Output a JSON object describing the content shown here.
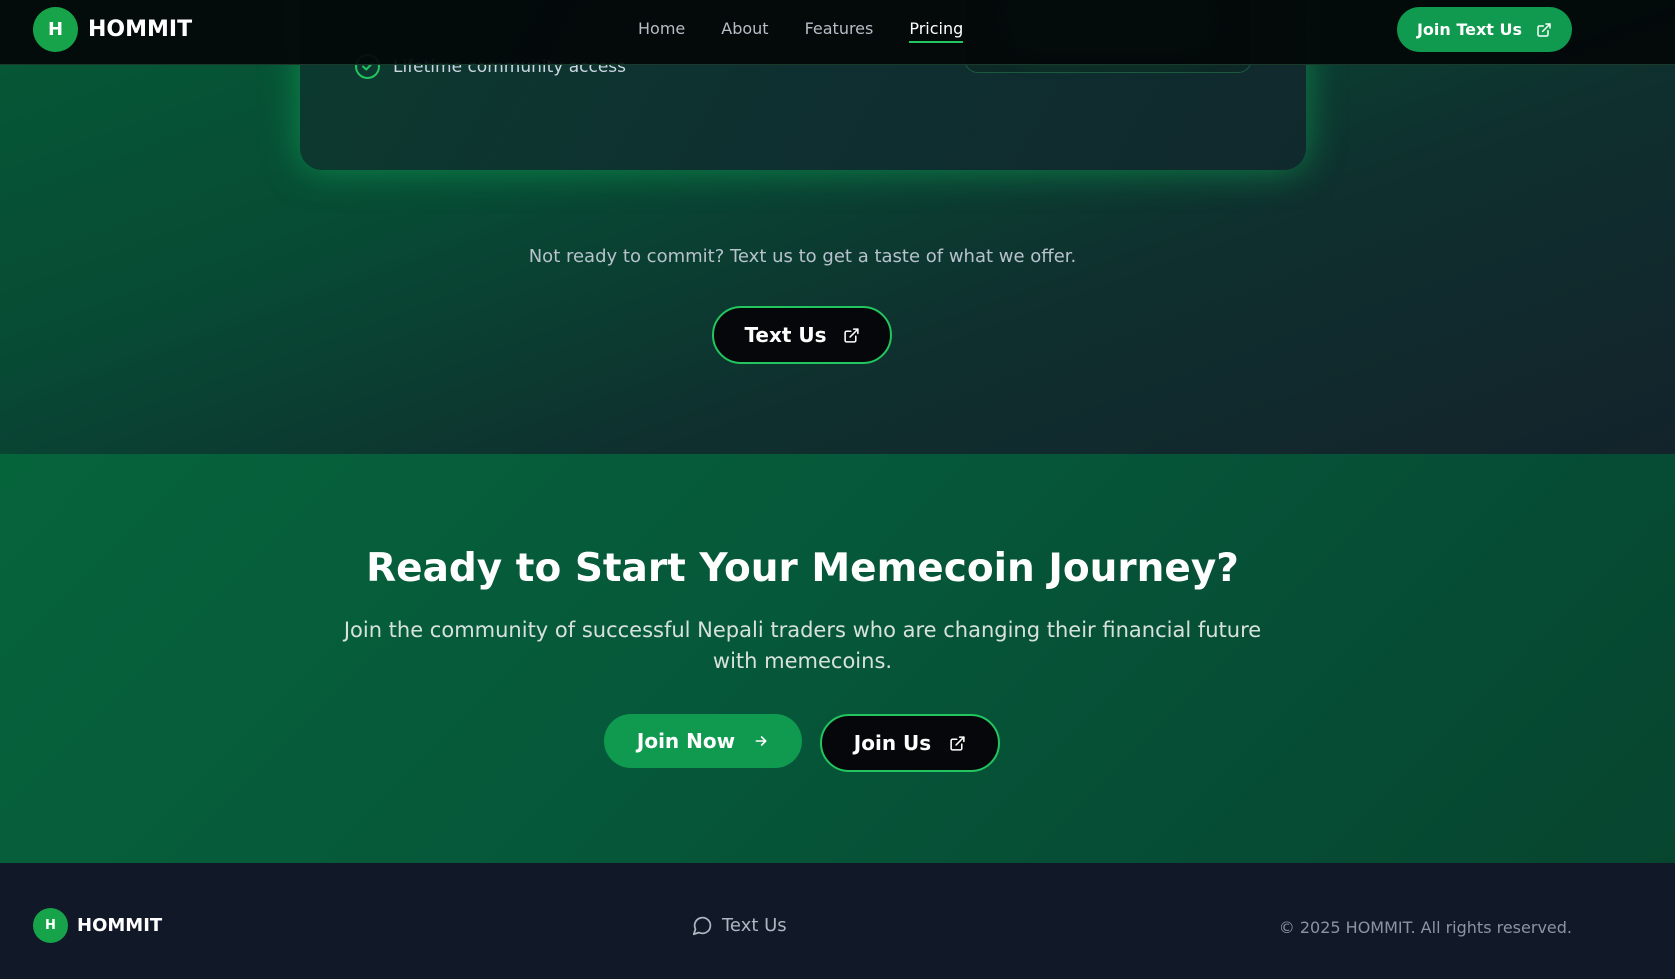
{
  "brand": {
    "logo_letter": "H",
    "name": "HOMMIT"
  },
  "nav": {
    "links": [
      {
        "label": "Home"
      },
      {
        "label": "About"
      },
      {
        "label": "Features"
      },
      {
        "label": "Pricing"
      }
    ],
    "active": "Pricing",
    "cta_label": "Join Text Us",
    "cta_icon": "external-link-icon"
  },
  "pricing": {
    "feature_partial": "Lifetime community access",
    "feature_icon": "check-circle-icon",
    "taste_text": "Not ready to commit? Text us to get a taste of what we offer.",
    "text_us_label": "Text Us",
    "text_us_icon": "external-link-icon"
  },
  "cta": {
    "title": "Ready to Start Your Memecoin Journey?",
    "subtitle": "Join the community of successful Nepali traders who are changing their financial future with memecoins.",
    "join_now_label": "Join Now",
    "join_now_icon": "arrow-right-icon",
    "join_us_label": "Join Us",
    "join_us_icon": "external-link-icon"
  },
  "footer": {
    "logo_letter": "H",
    "name": "HOMMIT",
    "text_us_label": "Text Us",
    "text_us_icon": "chat-bubble-icon",
    "copyright": "© 2025 HOMMIT. All rights reserved."
  },
  "colors": {
    "accent": "#16a34a",
    "accent_bright": "#22c55e",
    "button_green": "#0f9a4f",
    "dark_button": "#05070a",
    "footer_bg": "#111827",
    "navbar_bg": "#030608"
  }
}
